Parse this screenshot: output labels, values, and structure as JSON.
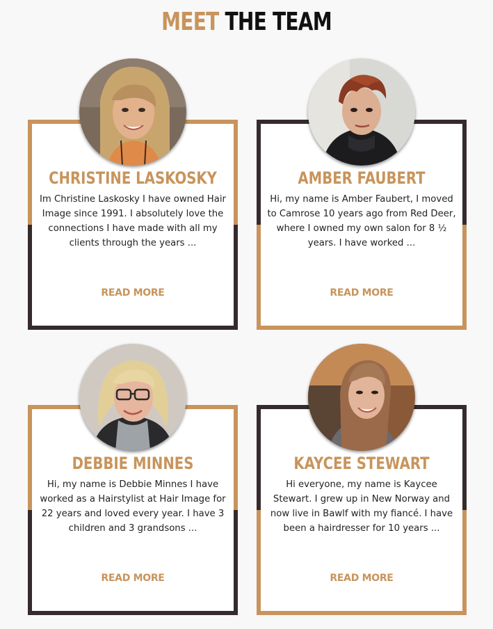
{
  "heading": {
    "accent": "MEET",
    "rest": "THE TEAM"
  },
  "colors": {
    "accent": "#c8945c",
    "dark": "#352a2c",
    "background": "#f8f8f8"
  },
  "team": [
    {
      "name": "CHRISTINE LASKOSKY",
      "bio": "Im Christine Laskosky I have owned Hair Image since 1991. I absolutely love the connections I have made with all my clients through the years ...",
      "read_more": "READ MORE",
      "photo_icon": "person-photo"
    },
    {
      "name": "AMBER FAUBERT",
      "bio": "Hi, my name is Amber Faubert, I moved to Camrose 10 years ago from Red Deer, where I owned my own salon for 8 ½ years. I have worked ...",
      "read_more": "READ MORE",
      "photo_icon": "person-photo"
    },
    {
      "name": "DEBBIE MINNES",
      "bio": "Hi, my name is Debbie Minnes I have worked as a Hairstylist at Hair Image for 22 years and loved every year. I have 3 children and 3 grandsons ...",
      "read_more": "READ MORE",
      "photo_icon": "person-photo"
    },
    {
      "name": "KAYCEE STEWART",
      "bio": "Hi everyone, my name is Kaycee Stewart. I grew up in New Norway and now live in Bawlf with my fiancé. I have been a hairdresser for 10 years ...",
      "read_more": "READ MORE",
      "photo_icon": "person-photo"
    }
  ]
}
